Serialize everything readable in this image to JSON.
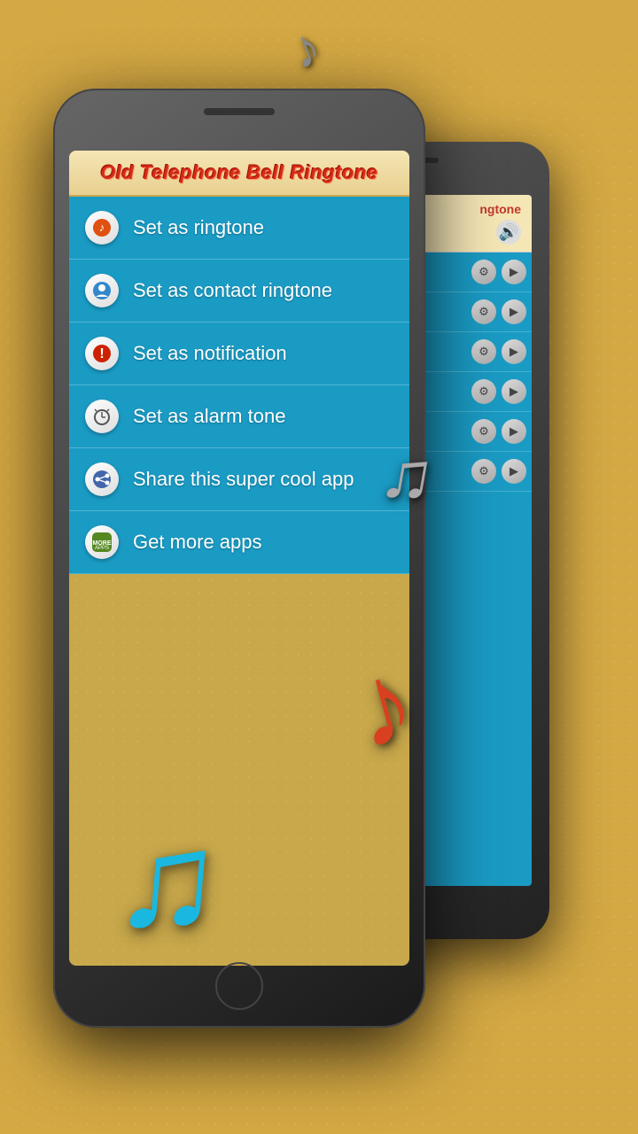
{
  "app": {
    "title": "Old Telephone Bell Ringtone"
  },
  "menu": {
    "items": [
      {
        "id": "set-ringtone",
        "icon": "🎵",
        "label": "Set as ringtone"
      },
      {
        "id": "set-contact-ringtone",
        "icon": "👤",
        "label": "Set as contact ringtone"
      },
      {
        "id": "set-notification",
        "icon": "🔔",
        "label": "Set as notification"
      },
      {
        "id": "set-alarm-tone",
        "icon": "⏰",
        "label": "Set as alarm tone"
      },
      {
        "id": "share-app",
        "icon": "↗",
        "label": "Share this super cool app"
      },
      {
        "id": "get-more-apps",
        "icon": "📱",
        "label": "Get more apps"
      }
    ]
  },
  "background_phone": {
    "title": "ngtone",
    "rows": 6
  },
  "decorations": {
    "note_top": "♪",
    "note_mid": "♫",
    "note_blue": "♫",
    "note_red": "♪"
  }
}
